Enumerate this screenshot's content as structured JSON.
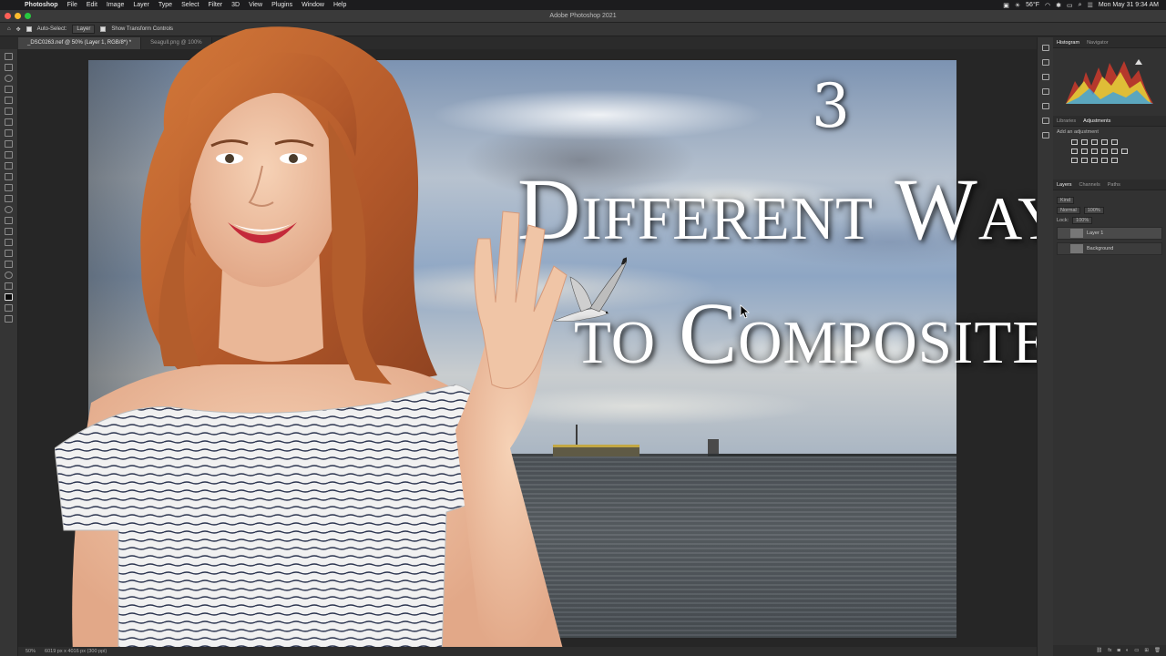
{
  "menubar": {
    "app": "Photoshop",
    "items": [
      "File",
      "Edit",
      "Image",
      "Layer",
      "Type",
      "Select",
      "Filter",
      "3D",
      "View",
      "Plugins",
      "Window",
      "Help"
    ],
    "temperature": "56°F",
    "datetime": "Mon May 31  9:34 AM"
  },
  "window": {
    "title": "Adobe Photoshop 2021"
  },
  "options": {
    "auto_select_label": "Auto-Select:",
    "auto_select_value": "Layer",
    "transform_label": "Show Transform Controls"
  },
  "tabs": [
    {
      "label": "_DSC0263.nef @ 50% (Layer 1, RGB/8*) *"
    },
    {
      "label": "Seagull.png @ 100%"
    }
  ],
  "overlay": {
    "number": "3",
    "line2": "Different Ways",
    "line3": "to Composite"
  },
  "panels": {
    "top_tabs": [
      "Histogram",
      "Navigator"
    ],
    "mid_tabs": [
      "Libraries",
      "Adjustments"
    ],
    "add_adjustment": "Add an adjustment",
    "layer_tabs": [
      "Layers",
      "Channels",
      "Paths"
    ],
    "kind_label": "Kind",
    "blend_mode": "Normal",
    "opacity": "100%",
    "lock_label": "Lock:",
    "fill": "100%",
    "layers": [
      {
        "name": "Layer 1"
      },
      {
        "name": "Background"
      }
    ]
  },
  "status": {
    "zoom": "50%",
    "doc_info": "6019 px x 4016 px (300 ppi)"
  },
  "colors": {
    "accent": "#1473e6",
    "menubar": "#1c1c1e",
    "panel": "#323232"
  }
}
